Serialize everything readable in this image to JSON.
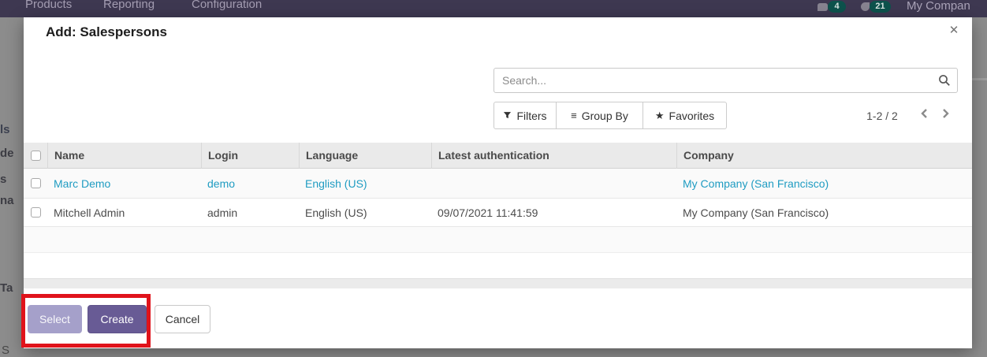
{
  "navbar": {
    "menu_items": [
      "Products",
      "Reporting",
      "Configuration"
    ],
    "badges": [
      {
        "count": "4"
      },
      {
        "count": "21"
      }
    ],
    "company": "My Compan"
  },
  "background_fragments": [
    "ls",
    "de",
    "s",
    "na",
    "Ta",
    "S"
  ],
  "dialog": {
    "title": "Add: Salespersons",
    "icons": {
      "close": "✕",
      "group_by": "≡",
      "favorites": "★"
    },
    "search": {
      "placeholder": "Search..."
    },
    "controls": {
      "filters": "Filters",
      "group_by": "Group By",
      "favorites": "Favorites"
    },
    "pager": {
      "range": "1-2 / 2"
    },
    "table": {
      "columns": [
        "Name",
        "Login",
        "Language",
        "Latest authentication",
        "Company"
      ],
      "rows": [
        {
          "name": "Marc Demo",
          "login": "demo",
          "language": "English (US)",
          "latest_authentication": "",
          "company": "My Company (San Francisco)"
        },
        {
          "name": "Mitchell Admin",
          "login": "admin",
          "language": "English (US)",
          "latest_authentication": "09/07/2021 11:41:59",
          "company": "My Company (San Francisco)"
        }
      ]
    },
    "footer": {
      "select": "Select",
      "create": "Create",
      "cancel": "Cancel"
    }
  },
  "colors": {
    "link": "#1f9cc2",
    "primary_button": "#685b95",
    "secondary_button": "#a5a0ca",
    "annotation": "#e0131b",
    "navbar": "#3e3851",
    "badge": "#0d524c"
  }
}
